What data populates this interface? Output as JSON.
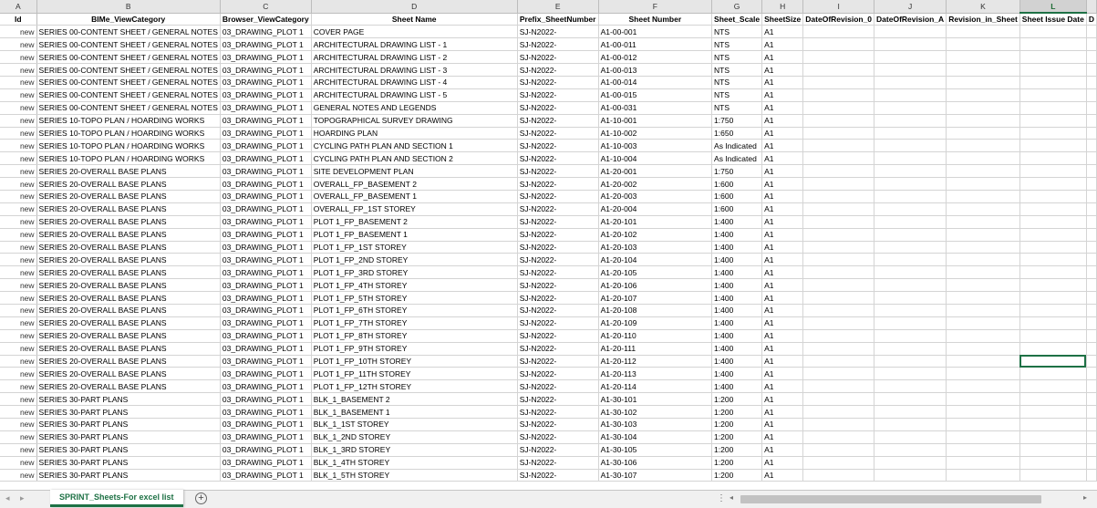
{
  "columns": [
    "A",
    "B",
    "C",
    "D",
    "E",
    "F",
    "G",
    "H",
    "I",
    "J",
    "K",
    "L",
    ""
  ],
  "headers": [
    "Id",
    "BIMe_ViewCategory",
    "Browser_ViewCategory",
    "Sheet Name",
    "Prefix_SheetNumber",
    "Sheet Number",
    "Sheet_Scale",
    "SheetSize",
    "DateOfRevision_0",
    "DateOfRevision_A",
    "Revision_in_Sheet",
    "Sheet Issue Date",
    "D"
  ],
  "rows": [
    [
      "new",
      "SERIES 00-CONTENT SHEET / GENERAL NOTES",
      "03_DRAWING_PLOT 1",
      "COVER PAGE",
      "SJ-N2022-",
      "A1-00-001",
      "NTS",
      "A1"
    ],
    [
      "new",
      "SERIES 00-CONTENT SHEET / GENERAL NOTES",
      "03_DRAWING_PLOT 1",
      "ARCHITECTURAL DRAWING LIST - 1",
      "SJ-N2022-",
      "A1-00-011",
      "NTS",
      "A1"
    ],
    [
      "new",
      "SERIES 00-CONTENT SHEET / GENERAL NOTES",
      "03_DRAWING_PLOT 1",
      "ARCHITECTURAL DRAWING LIST - 2",
      "SJ-N2022-",
      "A1-00-012",
      "NTS",
      "A1"
    ],
    [
      "new",
      "SERIES 00-CONTENT SHEET / GENERAL NOTES",
      "03_DRAWING_PLOT 1",
      "ARCHITECTURAL DRAWING LIST - 3",
      "SJ-N2022-",
      "A1-00-013",
      "NTS",
      "A1"
    ],
    [
      "new",
      "SERIES 00-CONTENT SHEET / GENERAL NOTES",
      "03_DRAWING_PLOT 1",
      "ARCHITECTURAL DRAWING LIST - 4",
      "SJ-N2022-",
      "A1-00-014",
      "NTS",
      "A1"
    ],
    [
      "new",
      "SERIES 00-CONTENT SHEET / GENERAL NOTES",
      "03_DRAWING_PLOT 1",
      "ARCHITECTURAL DRAWING LIST - 5",
      "SJ-N2022-",
      "A1-00-015",
      "NTS",
      "A1"
    ],
    [
      "new",
      "SERIES 00-CONTENT SHEET / GENERAL NOTES",
      "03_DRAWING_PLOT 1",
      "GENERAL NOTES AND LEGENDS",
      "SJ-N2022-",
      "A1-00-031",
      "NTS",
      "A1"
    ],
    [
      "new",
      "SERIES 10-TOPO PLAN / HOARDING WORKS",
      "03_DRAWING_PLOT 1",
      "TOPOGRAPHICAL SURVEY DRAWING",
      "SJ-N2022-",
      "A1-10-001",
      "1:750",
      "A1"
    ],
    [
      "new",
      "SERIES 10-TOPO PLAN / HOARDING WORKS",
      "03_DRAWING_PLOT 1",
      "HOARDING PLAN",
      "SJ-N2022-",
      "A1-10-002",
      "1:650",
      "A1"
    ],
    [
      "new",
      "SERIES 10-TOPO PLAN / HOARDING WORKS",
      "03_DRAWING_PLOT 1",
      "CYCLING PATH PLAN AND SECTION 1",
      "SJ-N2022-",
      "A1-10-003",
      "As Indicated",
      "A1"
    ],
    [
      "new",
      "SERIES 10-TOPO PLAN / HOARDING WORKS",
      "03_DRAWING_PLOT 1",
      "CYCLING PATH PLAN AND SECTION 2",
      "SJ-N2022-",
      "A1-10-004",
      "As Indicated",
      "A1"
    ],
    [
      "new",
      "SERIES 20-OVERALL BASE PLANS",
      "03_DRAWING_PLOT 1",
      "SITE DEVELOPMENT PLAN",
      "SJ-N2022-",
      "A1-20-001",
      "1:750",
      "A1"
    ],
    [
      "new",
      "SERIES 20-OVERALL BASE PLANS",
      "03_DRAWING_PLOT 1",
      "OVERALL_FP_BASEMENT 2",
      "SJ-N2022-",
      "A1-20-002",
      "1:600",
      "A1"
    ],
    [
      "new",
      "SERIES 20-OVERALL BASE PLANS",
      "03_DRAWING_PLOT 1",
      "OVERALL_FP_BASEMENT 1",
      "SJ-N2022-",
      "A1-20-003",
      "1:600",
      "A1"
    ],
    [
      "new",
      "SERIES 20-OVERALL BASE PLANS",
      "03_DRAWING_PLOT 1",
      "OVERALL_FP_1ST STOREY",
      "SJ-N2022-",
      "A1-20-004",
      "1:600",
      "A1"
    ],
    [
      "new",
      "SERIES 20-OVERALL BASE PLANS",
      "03_DRAWING_PLOT 1",
      "PLOT 1_FP_BASEMENT 2",
      "SJ-N2022-",
      "A1-20-101",
      "1:400",
      "A1"
    ],
    [
      "new",
      "SERIES 20-OVERALL BASE PLANS",
      "03_DRAWING_PLOT 1",
      "PLOT 1_FP_BASEMENT 1",
      "SJ-N2022-",
      "A1-20-102",
      "1:400",
      "A1"
    ],
    [
      "new",
      "SERIES 20-OVERALL BASE PLANS",
      "03_DRAWING_PLOT 1",
      "PLOT 1_FP_1ST STOREY",
      "SJ-N2022-",
      "A1-20-103",
      "1:400",
      "A1"
    ],
    [
      "new",
      "SERIES 20-OVERALL BASE PLANS",
      "03_DRAWING_PLOT 1",
      "PLOT 1_FP_2ND STOREY",
      "SJ-N2022-",
      "A1-20-104",
      "1:400",
      "A1"
    ],
    [
      "new",
      "SERIES 20-OVERALL BASE PLANS",
      "03_DRAWING_PLOT 1",
      "PLOT 1_FP_3RD STOREY",
      "SJ-N2022-",
      "A1-20-105",
      "1:400",
      "A1"
    ],
    [
      "new",
      "SERIES 20-OVERALL BASE PLANS",
      "03_DRAWING_PLOT 1",
      "PLOT 1_FP_4TH STOREY",
      "SJ-N2022-",
      "A1-20-106",
      "1:400",
      "A1"
    ],
    [
      "new",
      "SERIES 20-OVERALL BASE PLANS",
      "03_DRAWING_PLOT 1",
      "PLOT 1_FP_5TH STOREY",
      "SJ-N2022-",
      "A1-20-107",
      "1:400",
      "A1"
    ],
    [
      "new",
      "SERIES 20-OVERALL BASE PLANS",
      "03_DRAWING_PLOT 1",
      "PLOT 1_FP_6TH STOREY",
      "SJ-N2022-",
      "A1-20-108",
      "1:400",
      "A1"
    ],
    [
      "new",
      "SERIES 20-OVERALL BASE PLANS",
      "03_DRAWING_PLOT 1",
      "PLOT 1_FP_7TH STOREY",
      "SJ-N2022-",
      "A1-20-109",
      "1:400",
      "A1"
    ],
    [
      "new",
      "SERIES 20-OVERALL BASE PLANS",
      "03_DRAWING_PLOT 1",
      "PLOT 1_FP_8TH STOREY",
      "SJ-N2022-",
      "A1-20-110",
      "1:400",
      "A1"
    ],
    [
      "new",
      "SERIES 20-OVERALL BASE PLANS",
      "03_DRAWING_PLOT 1",
      "PLOT 1_FP_9TH STOREY",
      "SJ-N2022-",
      "A1-20-111",
      "1:400",
      "A1"
    ],
    [
      "new",
      "SERIES 20-OVERALL BASE PLANS",
      "03_DRAWING_PLOT 1",
      "PLOT 1_FP_10TH STOREY",
      "SJ-N2022-",
      "A1-20-112",
      "1:400",
      "A1"
    ],
    [
      "new",
      "SERIES 20-OVERALL BASE PLANS",
      "03_DRAWING_PLOT 1",
      "PLOT 1_FP_11TH STOREY",
      "SJ-N2022-",
      "A1-20-113",
      "1:400",
      "A1"
    ],
    [
      "new",
      "SERIES 20-OVERALL BASE PLANS",
      "03_DRAWING_PLOT 1",
      "PLOT 1_FP_12TH STOREY",
      "SJ-N2022-",
      "A1-20-114",
      "1:400",
      "A1"
    ],
    [
      "new",
      "SERIES 30-PART PLANS",
      "03_DRAWING_PLOT 1",
      "BLK_1_BASEMENT 2",
      "SJ-N2022-",
      "A1-30-101",
      "1:200",
      "A1"
    ],
    [
      "new",
      "SERIES 30-PART PLANS",
      "03_DRAWING_PLOT 1",
      "BLK_1_BASEMENT 1",
      "SJ-N2022-",
      "A1-30-102",
      "1:200",
      "A1"
    ],
    [
      "new",
      "SERIES 30-PART PLANS",
      "03_DRAWING_PLOT 1",
      "BLK_1_1ST STOREY",
      "SJ-N2022-",
      "A1-30-103",
      "1:200",
      "A1"
    ],
    [
      "new",
      "SERIES 30-PART PLANS",
      "03_DRAWING_PLOT 1",
      "BLK_1_2ND STOREY",
      "SJ-N2022-",
      "A1-30-104",
      "1:200",
      "A1"
    ],
    [
      "new",
      "SERIES 30-PART PLANS",
      "03_DRAWING_PLOT 1",
      "BLK_1_3RD STOREY",
      "SJ-N2022-",
      "A1-30-105",
      "1:200",
      "A1"
    ],
    [
      "new",
      "SERIES 30-PART PLANS",
      "03_DRAWING_PLOT 1",
      "BLK_1_4TH STOREY",
      "SJ-N2022-",
      "A1-30-106",
      "1:200",
      "A1"
    ],
    [
      "new",
      "SERIES 30-PART PLANS",
      "03_DRAWING_PLOT 1",
      "BLK_1_5TH STOREY",
      "SJ-N2022-",
      "A1-30-107",
      "1:200",
      "A1"
    ]
  ],
  "selected_column": "L",
  "sheet_tab": {
    "label": "SPRINT_Sheets-For excel list"
  },
  "tabbar": {
    "add_icon": "+",
    "nav_prev": "◂",
    "nav_next": "▸",
    "dots": "⋮",
    "scroll_left": "◂",
    "scroll_right": "▸"
  },
  "colors": {
    "accent": "#1e7145",
    "grid_line": "#d4d4d4",
    "header_bg": "#e6e6e6"
  }
}
